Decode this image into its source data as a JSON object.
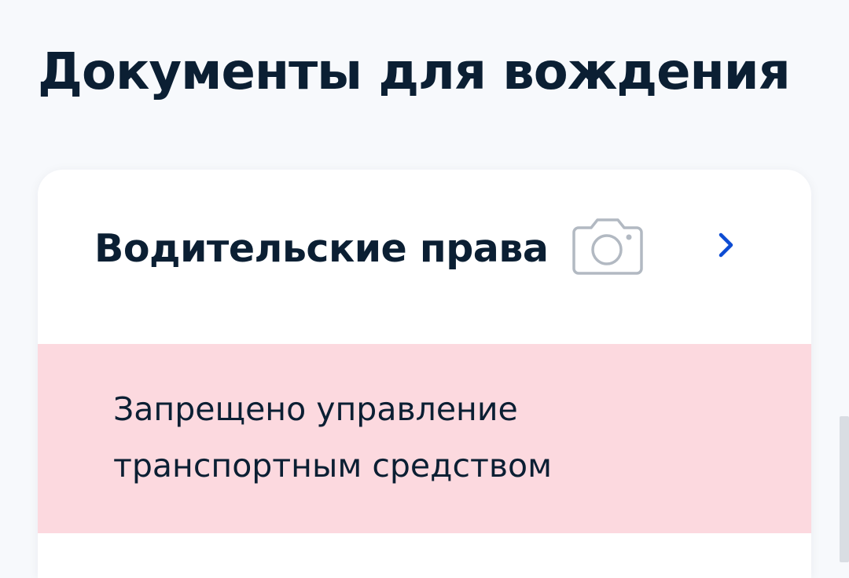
{
  "page": {
    "title": "Документы для вождения"
  },
  "driver_license": {
    "title": "Водительские права",
    "icons": {
      "photo": "camera-icon",
      "open": "chevron-right-icon"
    },
    "status": {
      "line_1": "Запрещено управление",
      "line_2": "транспортным средством",
      "color": "#fcd9df"
    }
  },
  "colors": {
    "background": "#f7f9fc",
    "text": "#0b1f33",
    "accent": "#0d4cd3",
    "icon_gray": "#b2b9c2"
  }
}
